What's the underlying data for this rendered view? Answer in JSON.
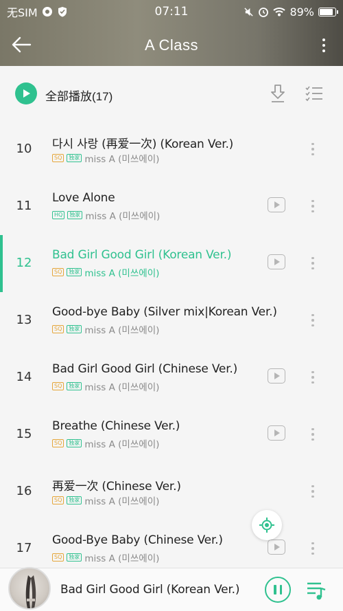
{
  "status_bar": {
    "carrier": "无SIM",
    "time": "07:11",
    "battery": "89%",
    "battery_level": 0.89
  },
  "header": {
    "title": "A Class",
    "back_icon": "back-arrow-icon",
    "more_icon": "more-vertical-icon"
  },
  "toolbar": {
    "play_all_label": "全部播放(17)",
    "download_icon": "download-icon",
    "multiselect_icon": "multiselect-list-icon"
  },
  "colors": {
    "accent": "#2fc18f",
    "tag_sq": "#e5a63a",
    "header_bg": "#7e7b6c"
  },
  "songs": [
    {
      "num": "10",
      "title": "다시 사랑 (再爱一次) (Korean Ver.)",
      "quality": "SQ",
      "exclusive": "独家",
      "artist": "miss A (미쓰에이)",
      "has_mv": false,
      "playing": false
    },
    {
      "num": "11",
      "title": "Love Alone",
      "quality": "HQ",
      "exclusive": "独家",
      "artist": "miss A (미쓰에이)",
      "has_mv": true,
      "playing": false
    },
    {
      "num": "12",
      "title": "Bad Girl Good Girl (Korean Ver.)",
      "quality": "SQ",
      "exclusive": "独家",
      "artist": "miss A (미쓰에이)",
      "has_mv": true,
      "playing": true
    },
    {
      "num": "13",
      "title": "Good-bye Baby (Silver mix|Korean Ver.)",
      "quality": "SQ",
      "exclusive": "独家",
      "artist": "miss A (미쓰에이)",
      "has_mv": false,
      "playing": false
    },
    {
      "num": "14",
      "title": "Bad Girl Good Girl (Chinese Ver.)",
      "quality": "SQ",
      "exclusive": "独家",
      "artist": "miss A (미쓰에이)",
      "has_mv": true,
      "playing": false
    },
    {
      "num": "15",
      "title": "Breathe (Chinese Ver.)",
      "quality": "SQ",
      "exclusive": "独家",
      "artist": "miss A (미쓰에이)",
      "has_mv": true,
      "playing": false
    },
    {
      "num": "16",
      "title": "再爱一次 (Chinese Ver.)",
      "quality": "SQ",
      "exclusive": "独家",
      "artist": "miss A (미쓰에이)",
      "has_mv": false,
      "playing": false
    },
    {
      "num": "17",
      "title": "Good-Bye Baby (Chinese Ver.)",
      "quality": "SQ",
      "exclusive": "独家",
      "artist": "miss A (미쓰에이)",
      "has_mv": true,
      "playing": false
    }
  ],
  "player": {
    "now_playing": "Bad Girl Good Girl (Korean Ver.)",
    "pause_icon": "pause-icon",
    "playlist_icon": "playlist-icon"
  }
}
